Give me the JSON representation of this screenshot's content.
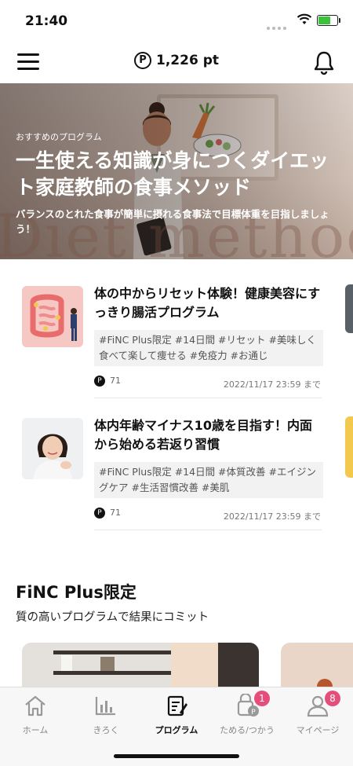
{
  "status_bar": {
    "time": "21:40"
  },
  "header": {
    "points": "1,226 pt",
    "points_icon": "P"
  },
  "hero": {
    "kicker": "おすすめのプログラム",
    "title": "一生使える知識が身につくダイエット家庭教師の食事メソッド",
    "description": "バランスのとれた食事が簡単に摂れる食事法で目標体重を目指しましょう！",
    "background_text": "Diet method"
  },
  "programs": [
    {
      "title": "体の中からリセット体験！健康美容にすっきり腸活プログラム",
      "tags": "#FiNC Plus限定 #14日間 #リセット #美味しく食べて楽して痩せる #免疫力 #お通じ",
      "points": "71",
      "deadline": "2022/11/17 23:59 まで"
    },
    {
      "title": "体内年齢マイナス10歳を目指す！内面から始める若返り習慣",
      "tags": "#FiNC Plus限定 #14日間 #体質改善 #エイジングケア #生活習慣改善 #美肌",
      "points": "71",
      "deadline": "2022/11/17 23:59 まで"
    }
  ],
  "section": {
    "title": "FiNC Plus限定",
    "subtitle": "質の高いプログラムで結果にコミット"
  },
  "tabbar": {
    "items": [
      {
        "label": "ホーム",
        "icon": "home-icon"
      },
      {
        "label": "きろく",
        "icon": "chart-icon"
      },
      {
        "label": "プログラム",
        "icon": "program-icon",
        "active": true
      },
      {
        "label": "ためる/つかう",
        "icon": "wallet-icon",
        "badge": "1"
      },
      {
        "label": "マイページ",
        "icon": "person-icon",
        "badge": "8"
      }
    ]
  },
  "colors": {
    "badge": "#e54d7a",
    "accent": "#111111"
  }
}
